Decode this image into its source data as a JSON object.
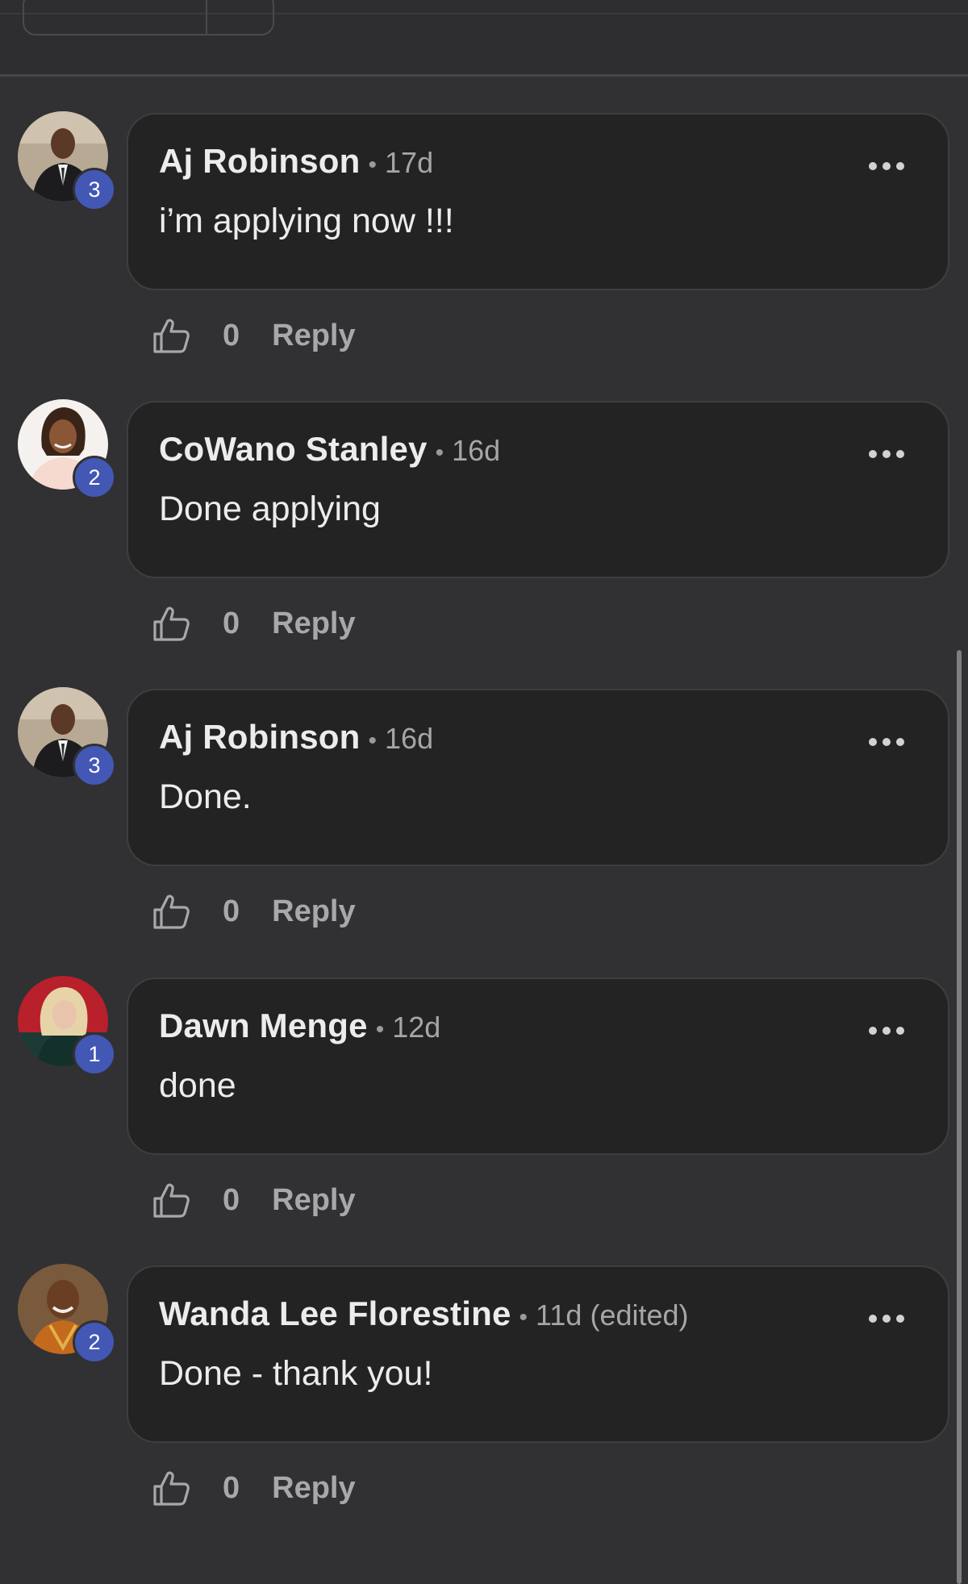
{
  "comments": [
    {
      "author": "Aj Robinson",
      "separator": "•",
      "time": "17d",
      "edited": "",
      "text": "i’m applying now !!!",
      "badge": "3",
      "like_count": "0",
      "reply_label": "Reply"
    },
    {
      "author": "CoWano Stanley",
      "separator": "•",
      "time": "16d",
      "edited": "",
      "text": "Done applying",
      "badge": "2",
      "like_count": "0",
      "reply_label": "Reply"
    },
    {
      "author": "Aj Robinson",
      "separator": "•",
      "time": "16d",
      "edited": "",
      "text": "Done.",
      "badge": "3",
      "like_count": "0",
      "reply_label": "Reply"
    },
    {
      "author": "Dawn Menge",
      "separator": "•",
      "time": "12d",
      "edited": "",
      "text": "done",
      "badge": "1",
      "like_count": "0",
      "reply_label": "Reply"
    },
    {
      "author": "Wanda Lee Florestine",
      "separator": "•",
      "time": "11d",
      "edited": "(edited)",
      "text": "Done - thank you!",
      "badge": "2",
      "like_count": "0",
      "reply_label": "Reply"
    }
  ],
  "icons": {
    "like": "thumbs-up-icon",
    "more": "more-horizontal-icon"
  },
  "colors": {
    "background": "#313133",
    "bubble": "#232324",
    "badge": "#4357b5",
    "text": "#ececec",
    "muted": "#a8a8aa"
  }
}
